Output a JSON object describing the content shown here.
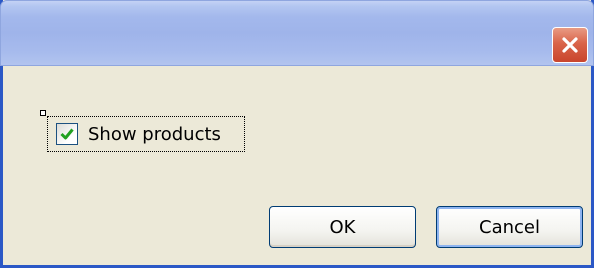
{
  "dialog": {
    "title": "",
    "close_icon": "close-icon",
    "checkbox": {
      "label": "Show products",
      "checked": true,
      "check_color": "#21a121"
    },
    "buttons": {
      "ok_label": "OK",
      "cancel_label": "Cancel"
    }
  }
}
